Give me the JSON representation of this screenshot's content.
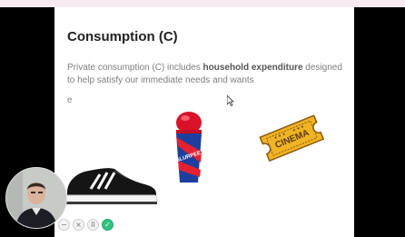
{
  "slide": {
    "title": "Consumption (C)",
    "body_before": "Private consumption (C) includes ",
    "body_bold": "household expenditure",
    "body_after": " designed to help satisfy our immediate needs and wants",
    "stray_char": "e"
  },
  "images": {
    "cup_text": "SLURPEE",
    "ticket_text": "CINEMA"
  },
  "controls": {
    "minus": "−",
    "close": "×",
    "pause": "II",
    "check": "✓"
  },
  "colors": {
    "background": "#000000",
    "slide": "#ffffff",
    "accent_green": "#2ec27e"
  }
}
